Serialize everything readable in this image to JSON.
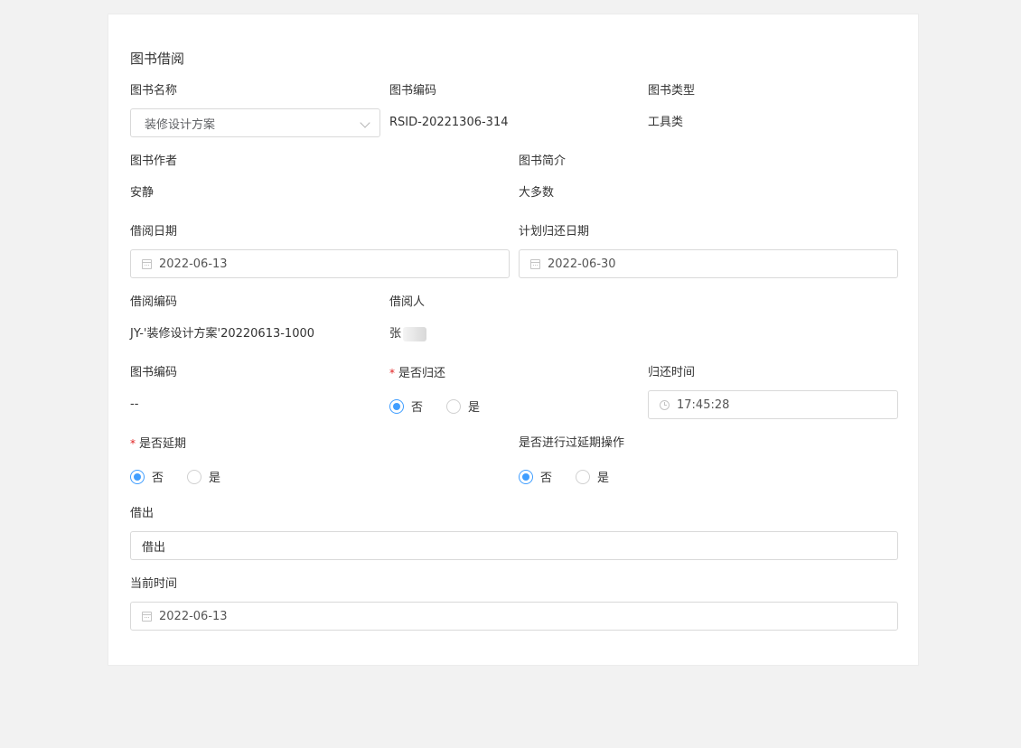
{
  "form": {
    "title": "图书借阅",
    "book_name_label": "图书名称",
    "book_name_value": "装修设计方案",
    "book_code_label": "图书编码",
    "book_code_value": "RSID-20221306-314",
    "book_type_label": "图书类型",
    "book_type_value": "工具类",
    "author_label": "图书作者",
    "author_value": "安静",
    "intro_label": "图书简介",
    "intro_value": "大多数",
    "borrow_date_label": "借阅日期",
    "borrow_date_value": "2022-06-13",
    "plan_return_label": "计划归还日期",
    "plan_return_value": "2022-06-30",
    "borrow_code_label": "借阅编码",
    "borrow_code_value": "JY-'装修设计方案'20220613-1000",
    "borrower_label": "借阅人",
    "borrower_value": "张",
    "book_code2_label": "图书编码",
    "book_code2_value": "--",
    "returned_label": "是否归还",
    "return_time_label": "归还时间",
    "return_time_value": "17:45:28",
    "extended_label": "是否延期",
    "extension_op_label": "是否进行过延期操作",
    "option_no": "否",
    "option_yes": "是",
    "checkout_label": "借出",
    "checkout_value": "借出",
    "current_time_label": "当前时间",
    "current_time_value": "2022-06-13"
  },
  "colors": {
    "accent": "#409eff",
    "required": "#e02020",
    "page_bg": "#f2f2f2",
    "border": "#d9d9d9"
  }
}
